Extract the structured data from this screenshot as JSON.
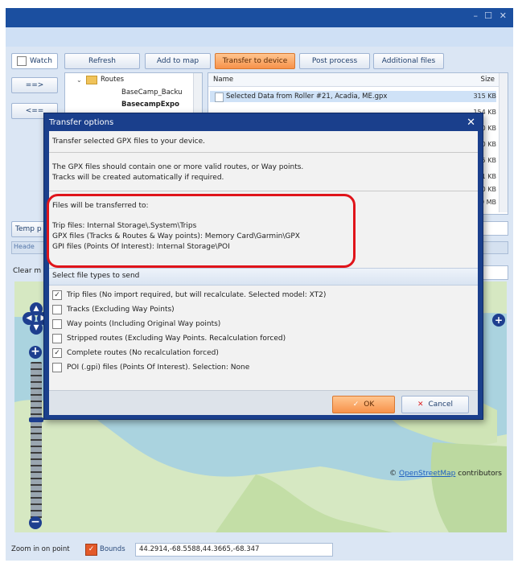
{
  "window": {
    "controls": [
      "–",
      "☐",
      "✕"
    ]
  },
  "toolbar": {
    "watch_label": "Watch",
    "refresh_label": "Refresh",
    "add_to_map_label": "Add to map",
    "transfer_label": "Transfer to device",
    "post_process_label": "Post process",
    "additional_files_label": "Additional files"
  },
  "nav": {
    "forward_label": "==>",
    "back_label": "<=="
  },
  "tree": {
    "root_label": "Routes",
    "items": [
      "BaseCamp_Backu",
      "BasecampExpo"
    ]
  },
  "file_list": {
    "col_name": "Name",
    "col_size": "Size",
    "rows": [
      "Selected Data from Roller #21, Acadia, ME.gpx"
    ],
    "sizes": [
      "315 KB",
      "154 KB",
      "160 KB",
      "120 KB",
      "215 KB",
      "121 KB",
      "120 KB",
      "129 MB"
    ]
  },
  "side": {
    "temp_label": "Temp p",
    "clear_label": "Clear m",
    "header_label": "Heade"
  },
  "map": {
    "attribution_prefix": "©",
    "attribution_link": "OpenStreetMap",
    "attribution_suffix": "contributors"
  },
  "bottom": {
    "zoom_label": "Zoom in on point",
    "bounds_label": "Bounds",
    "bounds_value": "44.2914,-68.5588,44.3665,-68.347"
  },
  "dialog": {
    "title": "Transfer options",
    "intro": "Transfer selected GPX files to your device.",
    "note1": "The GPX files should contain one or more valid routes, or Way points.",
    "note2": "Tracks will be created automatically if required.",
    "dest_header": "Files will be transferred to:",
    "dest_trip": "Trip files: Internal Storage\\.System\\Trips",
    "dest_gpx": "GPX files (Tracks & Routes & Way points): Memory Card\\Garmin\\GPX",
    "dest_gpi": "GPI files (Points Of Interest): Internal Storage\\POI",
    "section_title": "Select file types to send",
    "options": [
      {
        "label": "Trip files (No import required, but will recalculate. Selected model: XT2)",
        "checked": true
      },
      {
        "label": "Tracks (Excluding Way Points)",
        "checked": false
      },
      {
        "label": "Way points (Including Original Way points)",
        "checked": false
      },
      {
        "label": "Stripped routes (Excluding Way Points. Recalculation forced)",
        "checked": false
      },
      {
        "label": "Complete routes (No recalculation forced)",
        "checked": true
      },
      {
        "label": "POI (.gpi) files (Points Of Interest). Selection:  None",
        "checked": false
      }
    ],
    "ok_label": "OK",
    "cancel_label": "Cancel"
  },
  "colors": {
    "accent_blue": "#1a3f8c",
    "highlight_red": "#e0141a",
    "ok_orange": "#f7924a"
  }
}
